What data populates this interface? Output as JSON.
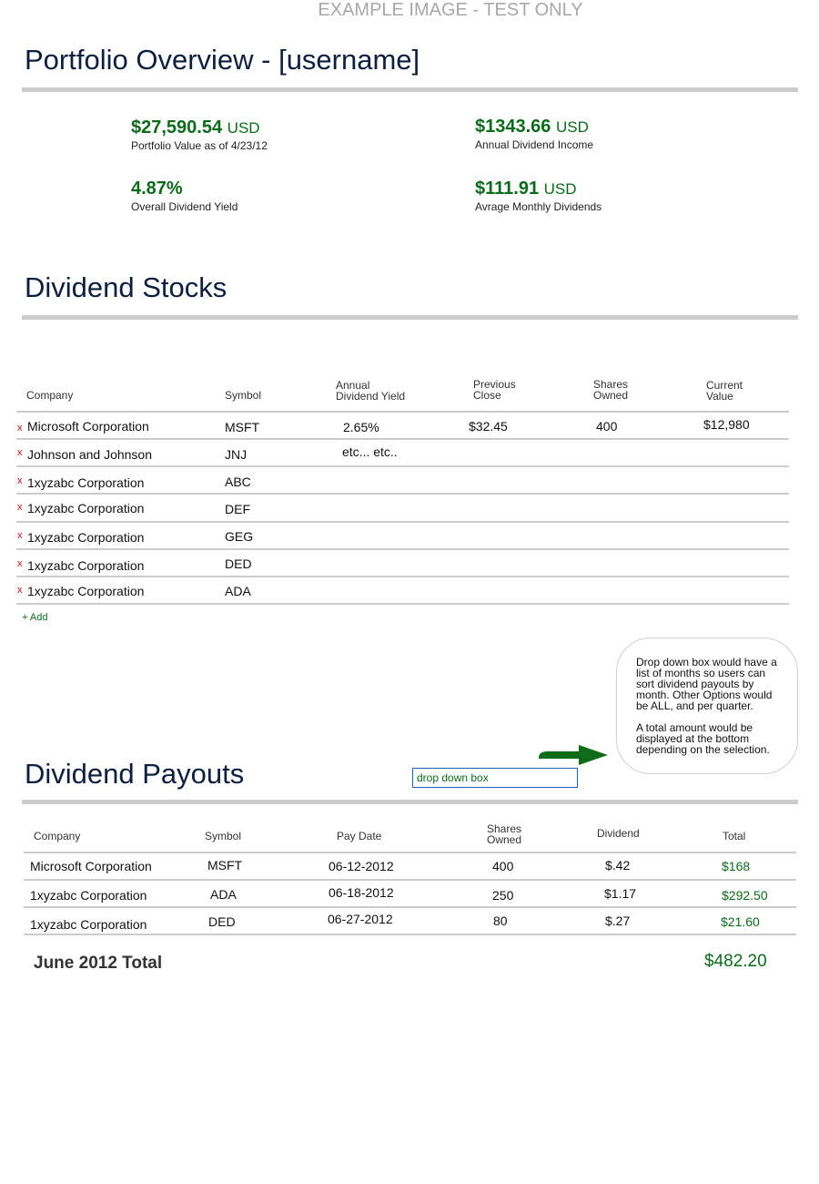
{
  "watermark": "EXAMPLE IMAGE - TEST ONLY",
  "overview": {
    "title": "Portfolio Overview - [username]",
    "stats": [
      {
        "value": "$27,590.54",
        "unit": "USD",
        "caption": "Portfolio Value as of 4/23/12"
      },
      {
        "value": "$1343.66",
        "unit": "USD",
        "caption": "Annual Dividend Income"
      },
      {
        "value": "4.87%",
        "unit": "",
        "caption": "Overall Dividend Yield"
      },
      {
        "value": "$111.91",
        "unit": "USD",
        "caption": "Avrage Monthly Dividends"
      }
    ]
  },
  "stocks": {
    "title": "Dividend Stocks",
    "headers": {
      "company": "Company",
      "symbol": "Symbol",
      "yield": [
        "Annual",
        "Dividend Yield"
      ],
      "prev_close": [
        "Previous",
        "Close"
      ],
      "shares": [
        "Shares",
        "Owned"
      ],
      "value": [
        "Current",
        "Value"
      ]
    },
    "remove_icon": "x",
    "rows": [
      {
        "company": "Microsoft Corporation",
        "symbol": "MSFT",
        "yield": "2.65%",
        "prev_close": "$32.45",
        "shares": "400",
        "value": "$12,980"
      },
      {
        "company": "Johnson and Johnson",
        "symbol": "JNJ",
        "yield": "etc... etc..",
        "prev_close": "",
        "shares": "",
        "value": ""
      },
      {
        "company": "1xyzabc Corporation",
        "symbol": "ABC"
      },
      {
        "company": "1xyzabc Corporation",
        "symbol": "DEF"
      },
      {
        "company": "1xyzabc Corporation",
        "symbol": "GEG"
      },
      {
        "company": "1xyzabc Corporation",
        "symbol": "DED"
      },
      {
        "company": "1xyzabc Corporation",
        "symbol": "ADA"
      }
    ],
    "add_label": "+ Add"
  },
  "note": {
    "paragraphs": [
      "Drop down box would have a list of months so users can sort dividend payouts by month.  Other Options would be ALL, and per quarter.",
      "A total amount would be displayed at the bottom depending on the selection."
    ]
  },
  "colors": {
    "accent_green": "#0b6b1a",
    "title_navy": "#0d1f3f",
    "remove_red": "#cc1111",
    "arrow_green": "#0e6b17"
  },
  "payouts": {
    "title": "Dividend Payouts",
    "dropdown_label": "drop down box",
    "headers": {
      "company": "Company",
      "symbol": "Symbol",
      "pay_date": "Pay Date",
      "shares": [
        "Shares",
        "Owned"
      ],
      "dividend": "Dividend",
      "total": "Total"
    },
    "rows": [
      {
        "company": "Microsoft Corporation",
        "symbol": "MSFT",
        "pay_date": "06-12-2012",
        "shares": "400",
        "dividend": "$.42",
        "total": "$168"
      },
      {
        "company": "1xyzabc Corporation",
        "symbol": "ADA",
        "pay_date": "06-18-2012",
        "shares": "250",
        "dividend": "$1.17",
        "total": "$292.50"
      },
      {
        "company": "1xyzabc Corporation",
        "symbol": "DED",
        "pay_date": "06-27-2012",
        "shares": "80",
        "dividend": "$.27",
        "total": "$21.60"
      }
    ],
    "total_label": "June 2012 Total",
    "total_value": "$482.20"
  }
}
